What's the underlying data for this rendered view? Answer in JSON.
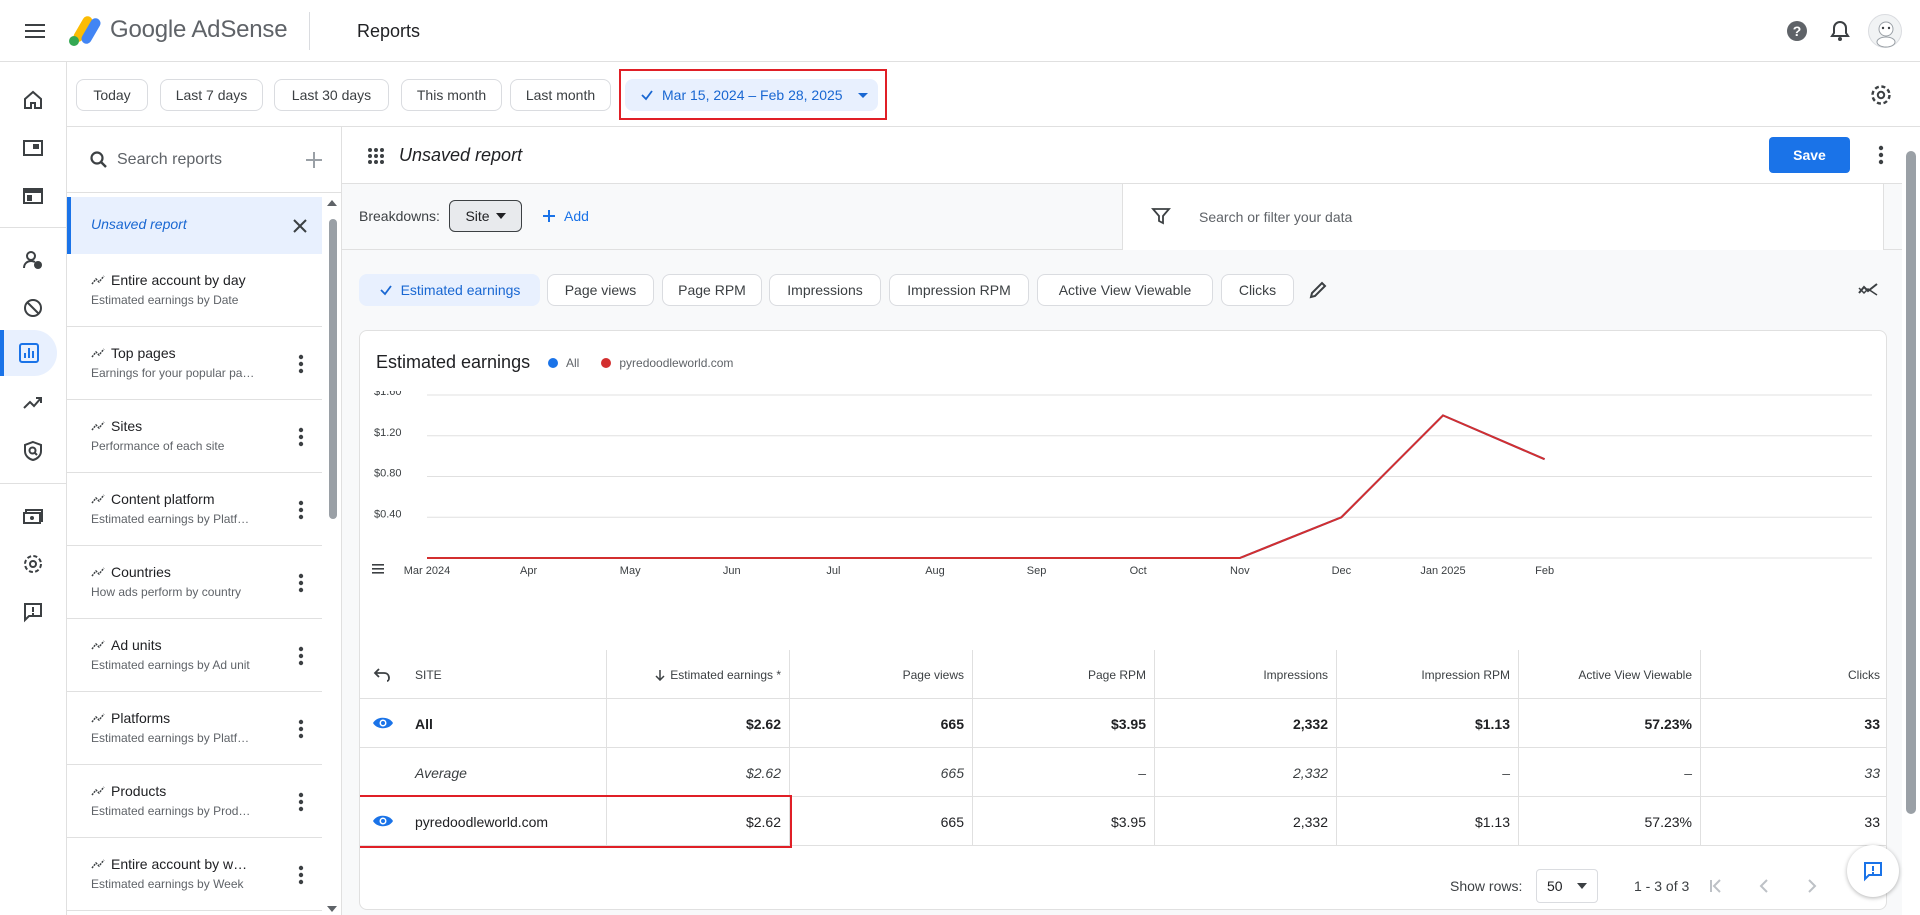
{
  "header": {
    "brand_google": "Google",
    "brand_product": "AdSense",
    "page_title": "Reports"
  },
  "date_filters": {
    "chips": [
      "Today",
      "Last 7 days",
      "Last 30 days",
      "This month",
      "Last month"
    ],
    "selected_range": "Mar 15, 2024 – Feb 28, 2025"
  },
  "sidebar": {
    "search_placeholder": "Search reports",
    "active_report": "Unsaved report",
    "reports": [
      {
        "title": "Entire account by day",
        "subtitle": "Estimated earnings by Date"
      },
      {
        "title": "Top pages",
        "subtitle": "Earnings for your popular pa…"
      },
      {
        "title": "Sites",
        "subtitle": "Performance of each site"
      },
      {
        "title": "Content platform",
        "subtitle": "Estimated earnings by Platf…"
      },
      {
        "title": "Countries",
        "subtitle": "How ads perform by country"
      },
      {
        "title": "Ad units",
        "subtitle": "Estimated earnings by Ad unit"
      },
      {
        "title": "Platforms",
        "subtitle": "Estimated earnings by Platf…"
      },
      {
        "title": "Products",
        "subtitle": "Estimated earnings by Prod…"
      },
      {
        "title": "Entire account by w…",
        "subtitle": "Estimated earnings by Week"
      }
    ]
  },
  "report": {
    "name": "Unsaved report",
    "save_label": "Save",
    "breakdowns_label": "Breakdowns:",
    "breakdown_value": "Site",
    "add_label": "Add",
    "filter_placeholder": "Search or filter your data",
    "metrics": [
      "Estimated earnings",
      "Page views",
      "Page RPM",
      "Impressions",
      "Impression RPM",
      "Active View Viewable",
      "Clicks"
    ],
    "selected_metric": "Estimated earnings"
  },
  "chart_data": {
    "type": "line",
    "title": "Estimated earnings",
    "x": [
      "Mar 2024",
      "Apr",
      "May",
      "Jun",
      "Jul",
      "Aug",
      "Sep",
      "Oct",
      "Nov",
      "Dec",
      "Jan 2025",
      "Feb"
    ],
    "series": [
      {
        "name": "All",
        "color": "#1a73e8",
        "values": [
          0,
          0,
          0,
          0,
          0,
          0,
          0,
          0,
          0,
          0.4,
          1.4,
          0.97
        ]
      },
      {
        "name": "pyredoodleworld.com",
        "color": "#d32f2f",
        "values": [
          0,
          0,
          0,
          0,
          0,
          0,
          0,
          0,
          0,
          0.4,
          1.4,
          0.97
        ]
      }
    ],
    "yticks": [
      "$0.40",
      "$0.80",
      "$1.20",
      "$1.60"
    ],
    "ylim": [
      0,
      1.6
    ],
    "grid": true
  },
  "table": {
    "columns": [
      "SITE",
      "Estimated earnings *",
      "Page views",
      "Page RPM",
      "Impressions",
      "Impression RPM",
      "Active View Viewable",
      "Clicks"
    ],
    "rows": [
      {
        "site": "All",
        "cells": [
          "$2.62",
          "665",
          "$3.95",
          "2,332",
          "$1.13",
          "57.23%",
          "33"
        ]
      },
      {
        "site": "Average",
        "cells": [
          "$2.62",
          "665",
          "–",
          "2,332",
          "–",
          "–",
          "33"
        ]
      },
      {
        "site": "pyredoodleworld.com",
        "cells": [
          "$2.62",
          "665",
          "$3.95",
          "2,332",
          "$1.13",
          "57.23%",
          "33"
        ]
      }
    ],
    "show_rows_label": "Show rows:",
    "rows_per_page": "50",
    "range_label": "1 - 3 of 3"
  },
  "colors": {
    "accent": "#1a73e8",
    "series_red": "#d32f2f",
    "highlight": "#e01f26"
  }
}
